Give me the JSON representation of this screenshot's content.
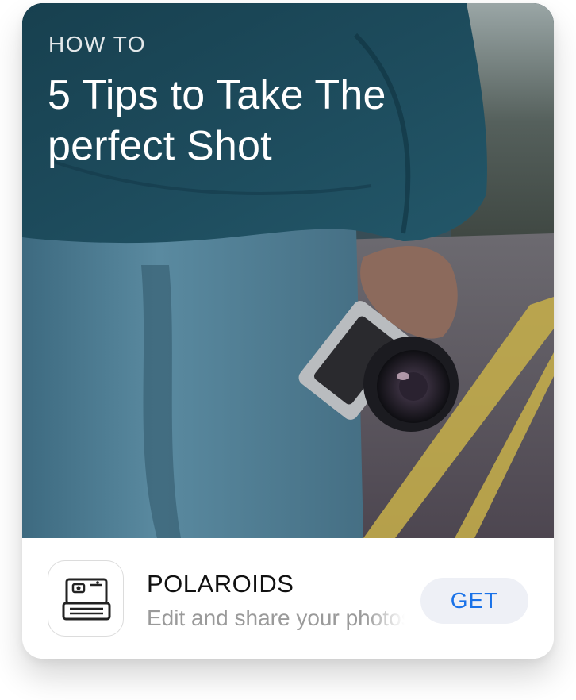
{
  "story": {
    "eyebrow": "HOW TO",
    "headline": "5 Tips to Take The perfect Shot"
  },
  "app": {
    "icon": "polaroid-camera-icon",
    "name": "POLAROIDS",
    "description": "Edit and share your photos",
    "get_label": "GET"
  },
  "colors": {
    "accent": "#1a72e8",
    "button_bg": "#eef0f6",
    "subtitle": "#9a9a9a"
  }
}
